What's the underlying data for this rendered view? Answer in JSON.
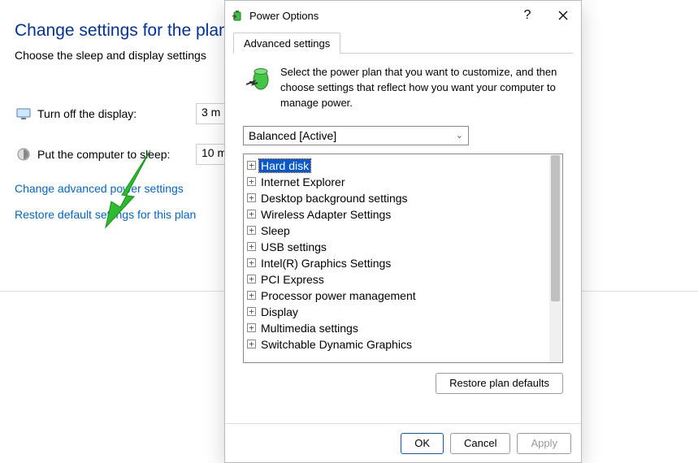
{
  "bg": {
    "title": "Change settings for the plan:",
    "subtext": "Choose the sleep and display settings",
    "rows": [
      {
        "label": "Turn off the display:",
        "value": "3 m"
      },
      {
        "label": "Put the computer to sleep:",
        "value": "10 m"
      }
    ],
    "link_advanced": "Change advanced power settings",
    "link_restore": "Restore default settings for this plan"
  },
  "dialog": {
    "title": "Power Options",
    "tab": "Advanced settings",
    "intro": "Select the power plan that you want to customize, and then choose settings that reflect how you want your computer to manage power.",
    "plan_selected": "Balanced [Active]",
    "tree": [
      {
        "label": "Hard disk",
        "selected": true
      },
      {
        "label": "Internet Explorer"
      },
      {
        "label": "Desktop background settings"
      },
      {
        "label": "Wireless Adapter Settings"
      },
      {
        "label": "Sleep"
      },
      {
        "label": "USB settings"
      },
      {
        "label": "Intel(R) Graphics Settings"
      },
      {
        "label": "PCI Express"
      },
      {
        "label": "Processor power management"
      },
      {
        "label": "Display"
      },
      {
        "label": "Multimedia settings"
      },
      {
        "label": "Switchable Dynamic Graphics"
      }
    ],
    "restore_btn": "Restore plan defaults",
    "buttons": {
      "ok": "OK",
      "cancel": "Cancel",
      "apply": "Apply"
    }
  }
}
